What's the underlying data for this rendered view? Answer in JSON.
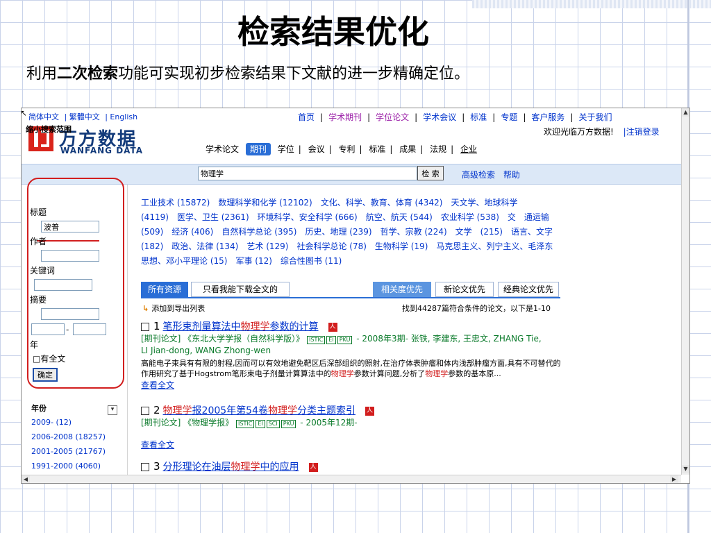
{
  "slide": {
    "title": "检索结果优化",
    "subtitle_pre": "利用",
    "subtitle_bold": "二次检索",
    "subtitle_post": "功能可实现初步检索结果下文献的进一步精确定位。"
  },
  "header": {
    "lang": [
      "简体中文",
      "| 繁體中文",
      "| English"
    ],
    "logo_cn": "万方数据",
    "logo_en": "WANFANG DATA",
    "topnav": [
      {
        "label": "首页",
        "color": "#0033cc"
      },
      {
        "label": "学术期刊",
        "color": "#9b1fa8"
      },
      {
        "label": "学位论文",
        "color": "#9b1fa8"
      },
      {
        "label": "学术会议",
        "color": "#0033cc"
      },
      {
        "label": "标准",
        "color": "#0033cc"
      },
      {
        "label": "专题",
        "color": "#0033cc"
      },
      {
        "label": "客户服务",
        "color": "#0033cc"
      },
      {
        "label": "关于我们",
        "color": "#0033cc"
      }
    ],
    "welcome": "欢迎光临万方数据!",
    "logout": "|注销登录",
    "catnav": [
      "学术论文",
      "期刊",
      "学位",
      "会议",
      "专利",
      "标准",
      "成果",
      "法规",
      "企业"
    ]
  },
  "search": {
    "value": "物理学",
    "button": "检 索",
    "advanced": "高级检索",
    "help": "帮助"
  },
  "sidebar": {
    "title": "缩小搜索范围",
    "title_label": "标题",
    "title_value": "波普",
    "author_label": "作者",
    "keyword_label": "关键词",
    "abstract_label": "摘要",
    "range_sep": "-",
    "year_label": "年",
    "fulltext_label": "□有全文",
    "confirm": "确定",
    "year_title": "年份",
    "years": [
      "2009- (12)",
      "2006-2008 (18257)",
      "2001-2005 (21767)",
      "1991-2000 (4060)"
    ]
  },
  "categories": [
    "工业技术 (15872)",
    "数理科学和化学 (12102)",
    "文化、科学、教育、体育 (4342)",
    "天文学、地球科学",
    "(4119)",
    "医学、卫生 (2361)",
    "环境科学、安全科学 (666)",
    "航空、航天 (544)",
    "农业科学 (538)",
    "交",
    "通运输 (509)",
    "经济 (406)",
    "自然科学总论 (395)",
    "历史、地理 (239)",
    "哲学、宗教 (224)",
    "文学",
    "(215)",
    "语言、文字 (182)",
    "政治、法律 (134)",
    "艺术 (129)",
    "社会科学总论 (78)",
    "生物科学 (19)",
    "马克思主义、列宁主义、毛泽东思想、邓小平理论 (15)",
    "军事 (12)",
    "综合性图书 (11)"
  ],
  "tabs": {
    "all": "所有资源",
    "downloadable": "只看我能下载全文的",
    "relevance": "相关度优先",
    "newest": "新论文优先",
    "classic": "经典论文优先"
  },
  "results_header": {
    "export": "添加到导出列表",
    "count": "找到44287篇符合条件的论文，以下是1-10"
  },
  "results": [
    {
      "num": "1",
      "title_parts": [
        "笔形束剂量算法中",
        "物理学",
        "参数的计算"
      ],
      "meta": "[期刊论文] 《东北大学学报（自然科学版）》",
      "badges": [
        "ISTIC",
        "EI",
        "PKU"
      ],
      "meta_tail": "- 2008年3期- 张铁, 李建东, 王忠文, ZHANG Tie,",
      "meta_line2": "LI Jian-dong, WANG Zhong-wen",
      "abstract_parts": [
        "高能电子束具有有限的射程,因而可以有效地避免靶区后深部组织的照射,在治疗体表肿瘤和体内浅部肿瘤方面,具有不可替代的作用研究了基于Hogstrom笔形束电子剂量计算算法中的",
        "物理学",
        "参数计算问题,分析了",
        "物理学",
        "参数的基本原",
        "..."
      ],
      "more": "查看全文"
    },
    {
      "num": "2",
      "title_parts": [
        "物理学",
        "报2005年第54卷",
        "物理学",
        "分类主题索引"
      ],
      "meta": "[期刊论文] 《物理学报》",
      "badges": [
        "ISTIC",
        "EI",
        "SCI",
        "PKU"
      ],
      "meta_tail": "- 2005年12期-",
      "more": "查看全文"
    },
    {
      "num": "3",
      "title_parts": [
        "分形理论在油层",
        "物理学",
        "中的应用"
      ]
    }
  ],
  "pdf_glyph": "人",
  "colors": {
    "accent": "#2a6ed6",
    "highlight": "#d21e1e",
    "meta": "#0a7a2a",
    "link": "#0033cc"
  }
}
